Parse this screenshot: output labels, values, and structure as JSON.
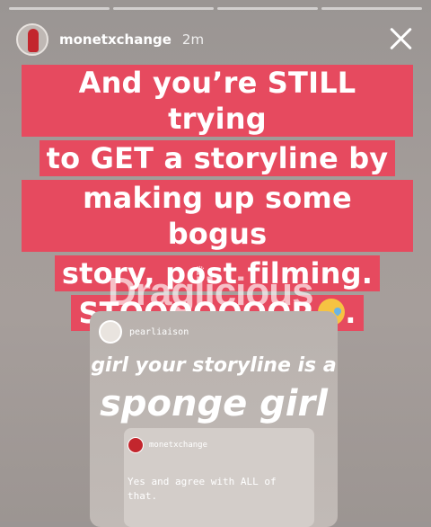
{
  "story": {
    "progress_segments": 4,
    "user": {
      "username": "monetxchange",
      "time_ago": "2m"
    }
  },
  "caption": {
    "lines": [
      "And you’re STILL trying",
      "to GET a storyline by",
      "making up some bogus",
      "story, post filming.",
      "STOOOOOOOP"
    ],
    "emoji": "sleepy-face-emoji",
    "trailing": ".",
    "highlight_color": "#e64a5f"
  },
  "watermark": {
    "brand": "Draglicious"
  },
  "shared_story": {
    "username": "pearliaison",
    "line1": "girl your storyline is a",
    "line2": "sponge girl",
    "quoted": {
      "username": "monetxchange",
      "text": "Yes and agree with ALL of that."
    }
  }
}
